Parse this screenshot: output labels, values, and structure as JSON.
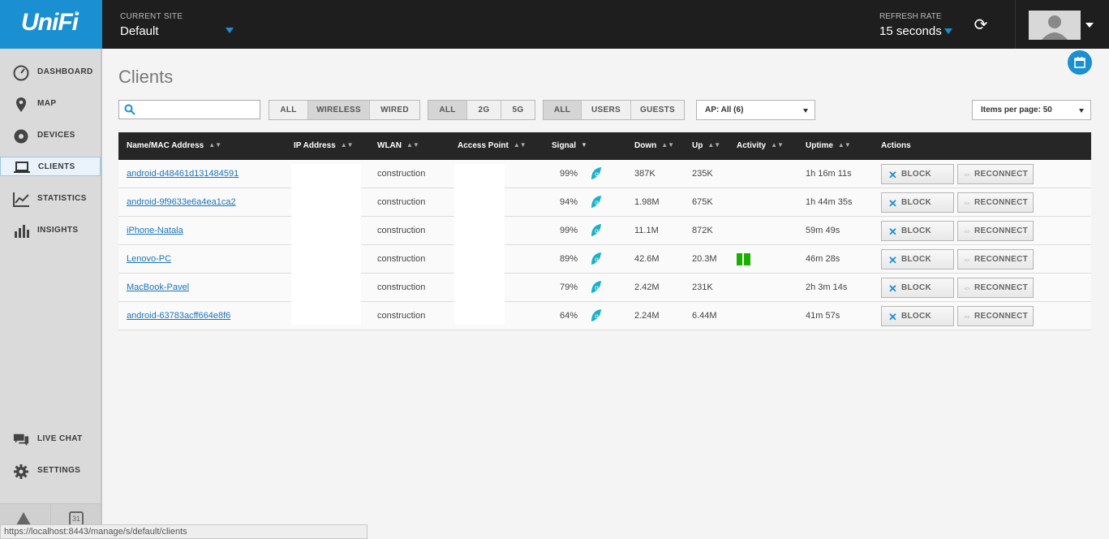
{
  "app": {
    "logo_text": "UniFi",
    "logo_mark": "®"
  },
  "header": {
    "site_label": "CURRENT SITE",
    "site_value": "Default",
    "refresh_label": "REFRESH RATE",
    "refresh_value": "15 seconds"
  },
  "sidebar": {
    "items": [
      {
        "label": "DASHBOARD",
        "icon": "dashboard-icon"
      },
      {
        "label": "MAP",
        "icon": "map-pin-icon"
      },
      {
        "label": "DEVICES",
        "icon": "devices-icon"
      },
      {
        "label": "CLIENTS",
        "icon": "laptop-icon",
        "active": true
      },
      {
        "label": "STATISTICS",
        "icon": "line-chart-icon"
      },
      {
        "label": "INSIGHTS",
        "icon": "bar-chart-icon"
      },
      {
        "label": "LIVE CHAT",
        "icon": "chat-icon"
      },
      {
        "label": "SETTINGS",
        "icon": "gear-icon"
      }
    ],
    "calendar_day": "31"
  },
  "page": {
    "title": "Clients"
  },
  "filters": {
    "search_placeholder": "",
    "connection": [
      "ALL",
      "WIRELESS",
      "WIRED"
    ],
    "connection_selected": "WIRELESS",
    "band": [
      "ALL",
      "2G",
      "5G"
    ],
    "band_selected": "ALL",
    "type": [
      "ALL",
      "USERS",
      "GUESTS"
    ],
    "type_selected": "ALL",
    "ap_select": "AP: All (6)",
    "items_per_page": "Items per page: 50"
  },
  "table": {
    "headers": {
      "name": "Name/MAC Address",
      "ip": "IP Address",
      "wlan": "WLAN",
      "ap": "Access Point",
      "signal": "Signal",
      "down": "Down",
      "up": "Up",
      "activity": "Activity",
      "uptime": "Uptime",
      "actions": "Actions"
    },
    "rows": [
      {
        "name": "android-d48461d131484591",
        "wlan": "construction",
        "signal": "99%",
        "down": "387K",
        "up": "235K",
        "activity": 0,
        "uptime": "1h 16m 11s"
      },
      {
        "name": "android-9f9633e6a4ea1ca2",
        "wlan": "construction",
        "signal": "94%",
        "down": "1.98M",
        "up": "675K",
        "activity": 0,
        "uptime": "1h 44m 35s"
      },
      {
        "name": "iPhone-Natala",
        "wlan": "construction",
        "signal": "99%",
        "down": "11.1M",
        "up": "872K",
        "activity": 0,
        "uptime": "59m 49s"
      },
      {
        "name": "Lenovo-PC",
        "wlan": "construction",
        "signal": "89%",
        "down": "42.6M",
        "up": "20.3M",
        "activity": 2,
        "uptime": "46m 28s"
      },
      {
        "name": "MacBook-Pavel",
        "wlan": "construction",
        "signal": "79%",
        "down": "2.42M",
        "up": "231K",
        "activity": 0,
        "uptime": "2h 3m 14s"
      },
      {
        "name": "android-63783acff664e8f6",
        "wlan": "construction",
        "signal": "64%",
        "down": "2.24M",
        "up": "6.44M",
        "activity": 0,
        "uptime": "41m 57s"
      }
    ],
    "block_label": "BLOCK",
    "reconnect_label": "RECONNECT"
  },
  "status_url": "https://localhost:8443/manage/s/default/clients",
  "colors": {
    "accent": "#1a8fd1",
    "topbar": "#1e1e1e",
    "activity": "#19b000"
  }
}
